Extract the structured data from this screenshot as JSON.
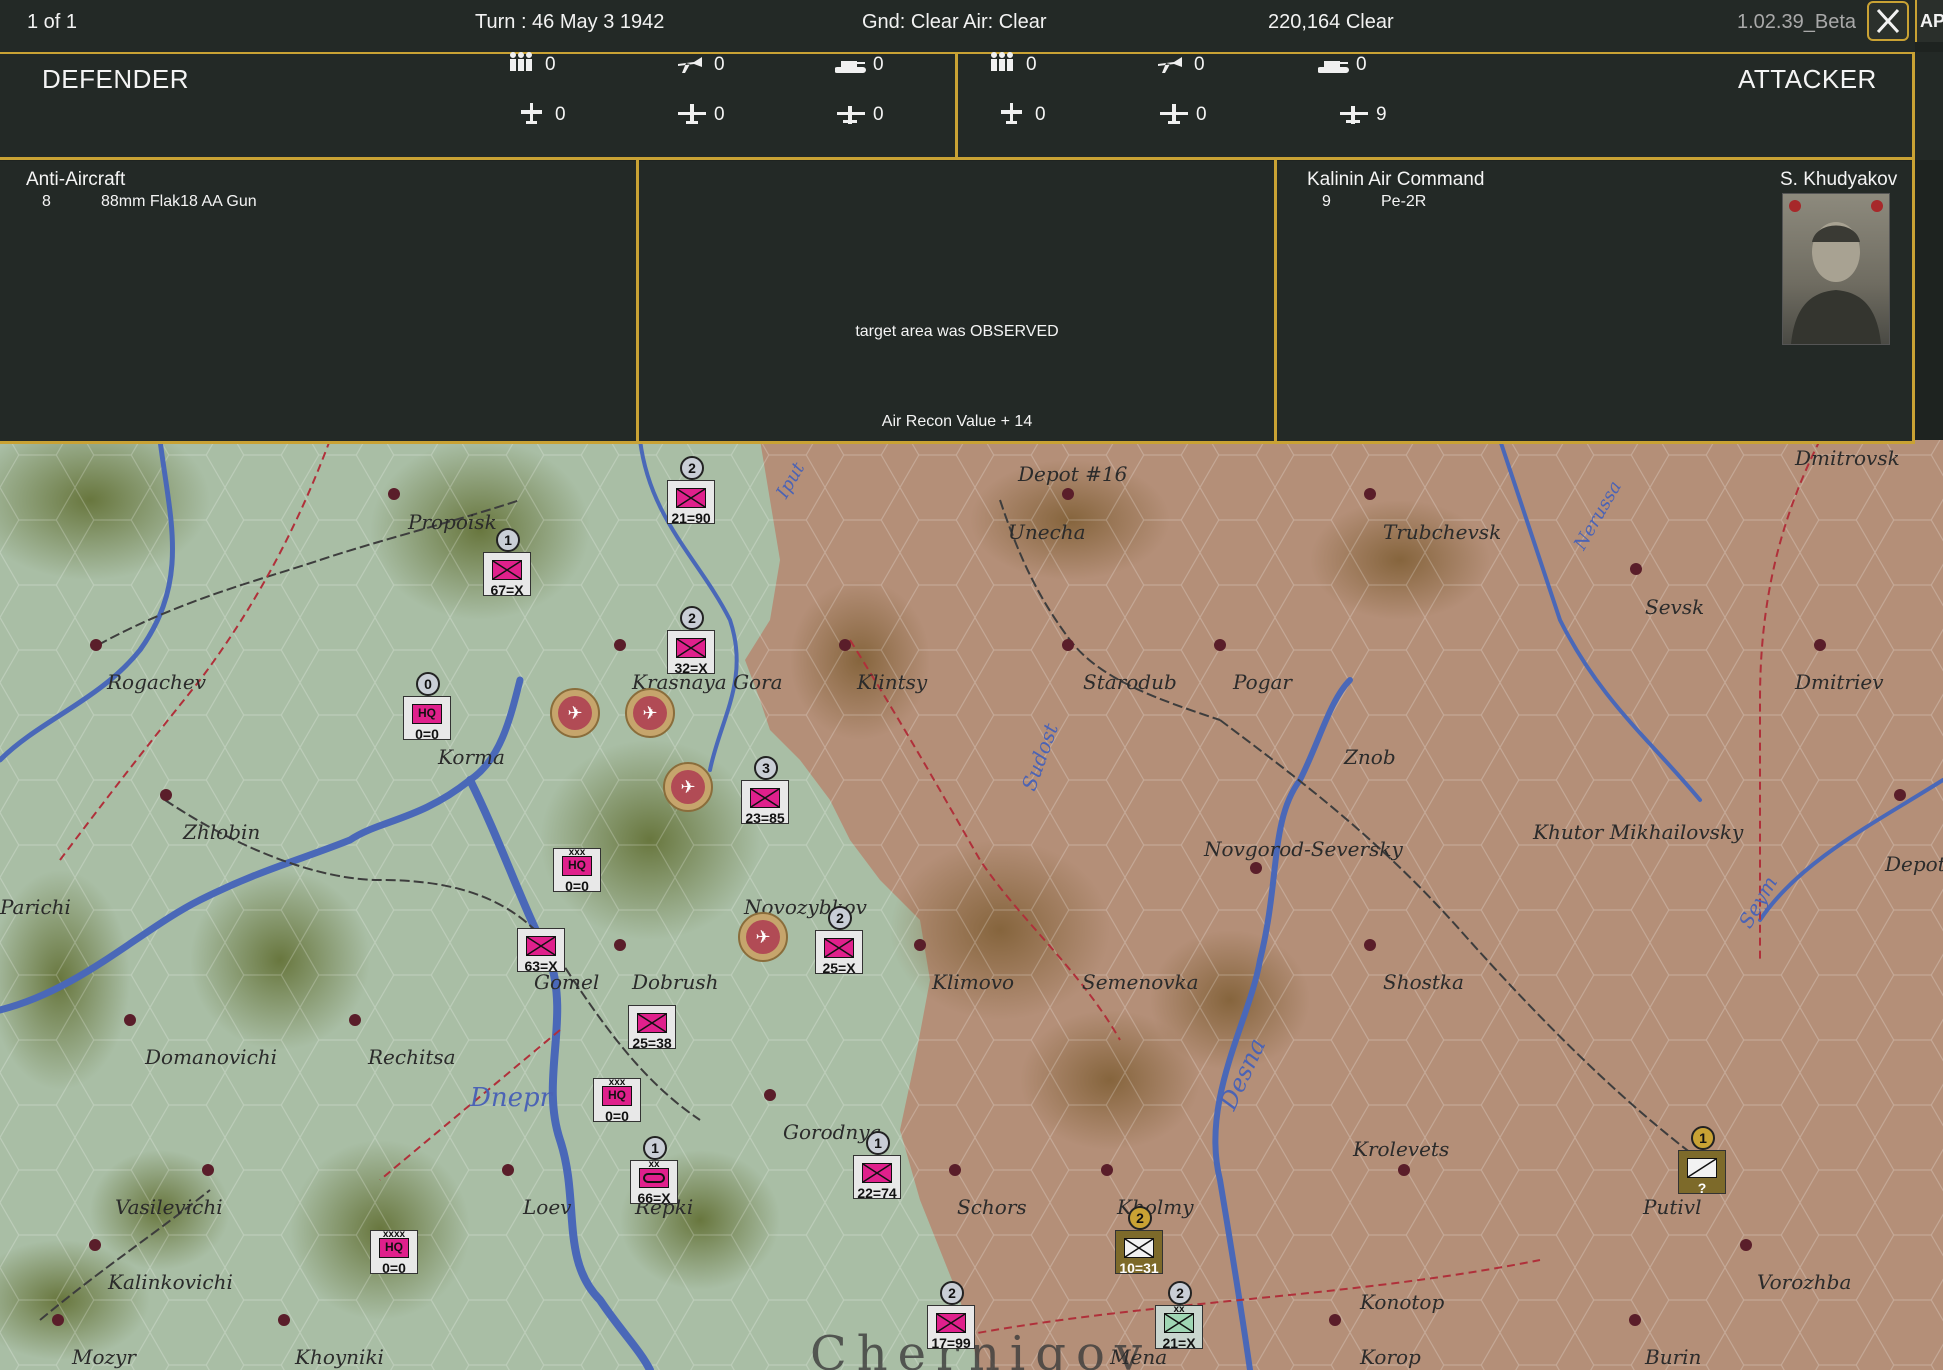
{
  "topbar": {
    "page": "1 of 1",
    "turn": "Turn : 46   May 3 1942",
    "weather": "Gnd: Clear  Air: Clear",
    "count": "220,164   Clear",
    "version": "1.02.39_Beta",
    "side_tab": "AP"
  },
  "defender": {
    "title": "DEFENDER",
    "stats": [
      {
        "icon": "infantry-icon",
        "value": "0"
      },
      {
        "icon": "fighter-icon",
        "value": "0"
      },
      {
        "icon": "tank-icon",
        "value": "0"
      },
      {
        "icon": "plane-icon",
        "value": "0"
      },
      {
        "icon": "bomber-icon",
        "value": "0"
      },
      {
        "icon": "transport-plane-icon",
        "value": "0"
      }
    ],
    "unit_type": "Anti-Aircraft",
    "rows": [
      {
        "count": "8",
        "name": "88mm Flak18 AA Gun"
      }
    ]
  },
  "attacker": {
    "title": "ATTACKER",
    "stats": [
      {
        "icon": "infantry-icon",
        "value": "0"
      },
      {
        "icon": "fighter-icon",
        "value": "0"
      },
      {
        "icon": "tank-icon",
        "value": "0"
      },
      {
        "icon": "plane-icon",
        "value": "0"
      },
      {
        "icon": "bomber-icon",
        "value": "0"
      },
      {
        "icon": "transport-plane-icon",
        "value": "9"
      }
    ],
    "unit_type": "Kalinin Air Command",
    "commander": "S. Khudyakov",
    "rows": [
      {
        "count": "9",
        "name": "Pe-2R"
      }
    ]
  },
  "result": {
    "message": "target area was OBSERVED",
    "recon": "Air Recon Value  + 14"
  },
  "colors": {
    "gold": "#c9a234",
    "panel": "#232926",
    "soviet_unit": "#e0208c",
    "axis_unit": "#7d6a2a"
  },
  "map": {
    "places": [
      "Propoisk",
      "Depot #16",
      "Unecha",
      "Trubchevsk",
      "Sevsk",
      "Dmitrovsk",
      "Rogachev",
      "Krasnaya Gora",
      "Klintsy",
      "Starodub",
      "Pogar",
      "Dmitriev",
      "Korma",
      "Znob",
      "Zhlobin",
      "Khutor Mikhailovsky",
      "Novgorod-Seversky",
      "Depot",
      "Parichi",
      "Novozybkov",
      "Klimovo",
      "Semenovka",
      "Shostka",
      "Gomel",
      "Dobrush",
      "Domanovichi",
      "Rechitsa",
      "Gorodnya",
      "Krolevets",
      "Vasilevichi",
      "Loev",
      "Repki",
      "Schors",
      "Kholmy",
      "Putivl",
      "Kalinkovichi",
      "Vorozhba",
      "Konotop",
      "Mozyr",
      "Khoyniki",
      "Mena",
      "Korop",
      "Burin",
      "Chernigov"
    ],
    "rivers": [
      "Iput",
      "Desna",
      "Sudost",
      "Nerussa",
      "Seym",
      "Dnepr"
    ],
    "units": [
      {
        "label": "21=90",
        "badge": "2",
        "type": "infantry"
      },
      {
        "label": "67=X",
        "badge": "1",
        "type": "infantry"
      },
      {
        "label": "32=X",
        "badge": "2",
        "type": "infantry"
      },
      {
        "label": "0=0",
        "badge": "0",
        "type": "hq",
        "size": ""
      },
      {
        "label": "23=85",
        "badge": "3",
        "type": "infantry"
      },
      {
        "label": "0=0",
        "badge": "",
        "type": "hq",
        "size": "xxx"
      },
      {
        "label": "63=X",
        "badge": "",
        "type": "infantry"
      },
      {
        "label": "25=X",
        "badge": "2",
        "type": "infantry"
      },
      {
        "label": "25=38",
        "badge": "",
        "type": "infantry"
      },
      {
        "label": "0=0",
        "badge": "",
        "type": "hq",
        "size": "xxx"
      },
      {
        "label": "66=X",
        "badge": "1",
        "type": "armor",
        "size": "xx"
      },
      {
        "label": "22=74",
        "badge": "1",
        "type": "infantry"
      },
      {
        "label": "0=0",
        "badge": "",
        "type": "hq",
        "size": "xxxx"
      },
      {
        "label": "10=31",
        "badge": "2",
        "type": "axis-infantry"
      },
      {
        "label": "17=99",
        "badge": "2",
        "type": "infantry"
      },
      {
        "label": "21=X",
        "badge": "2",
        "type": "axis-infantry2",
        "size": "xx"
      },
      {
        "label": "?",
        "badge": "1",
        "type": "axis-unknown"
      }
    ]
  }
}
